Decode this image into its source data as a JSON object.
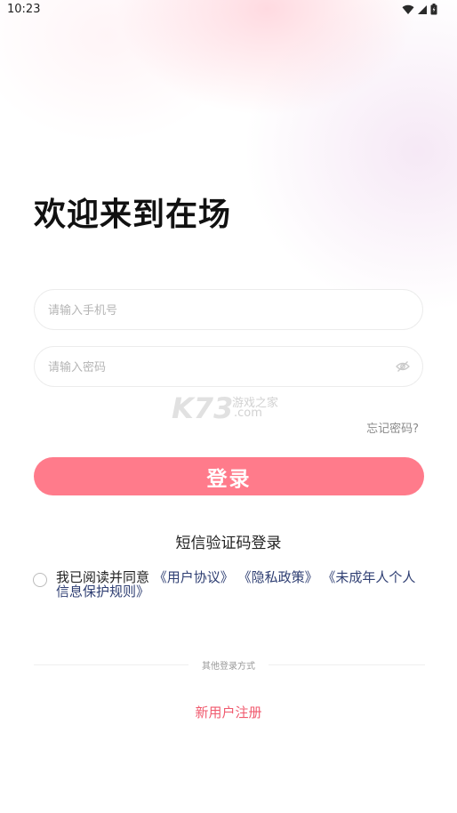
{
  "status_bar": {
    "time": "10:23",
    "icons": [
      "wifi-icon",
      "signal-icon",
      "battery-icon"
    ]
  },
  "title": "欢迎来到在场",
  "phone_field": {
    "value": "",
    "placeholder": "请输入手机号"
  },
  "password_field": {
    "value": "",
    "placeholder": "请输入密码",
    "toggle_icon": "eye-off-icon"
  },
  "watermark": {
    "logo": "K73",
    "text": "游戏之家",
    "domain": ".com"
  },
  "forgot_password": "忘记密码?",
  "login_button": "登录",
  "sms_login": "短信验证码登录",
  "agreement": {
    "prefix": "我已阅读并同意 ",
    "user_agreement": "《用户协议》",
    "privacy_policy": "《隐私政策》",
    "minor_policy": "《未成年人个人信息保护规则》"
  },
  "other_login": "其他登录方式",
  "register": "新用户注册",
  "colors": {
    "primary_button": "#ff7b8b",
    "register_text": "#f05a6e",
    "link_text": "#2f3f73"
  }
}
